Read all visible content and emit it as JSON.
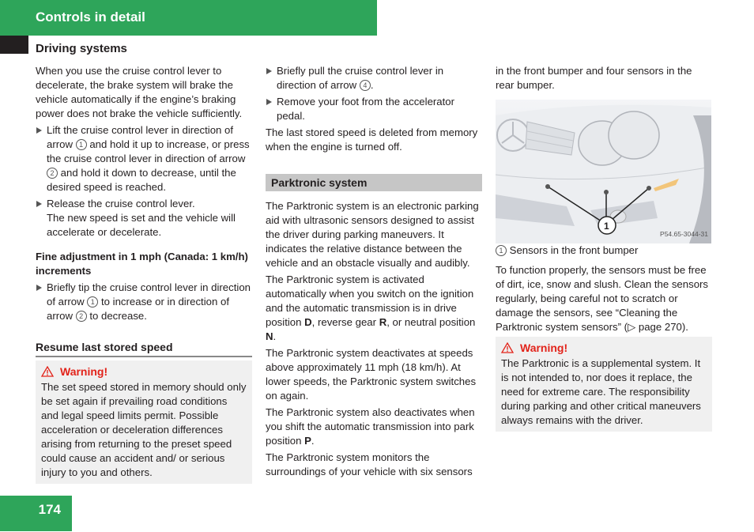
{
  "header": {
    "title": "Controls in detail"
  },
  "section_title": "Driving systems",
  "page_number": "174",
  "colors": {
    "accent_green": "#2ea55a",
    "warning_red": "#e2231a",
    "box_gray": "#f0f0f0",
    "heading_gray": "#c6c6c6"
  },
  "col1": {
    "intro": "When you use the cruise control lever to decelerate, the brake system will brake the vehicle automatically if the engine’s braking power does not brake the vehicle sufficiently.",
    "step1": {
      "a": "Lift the cruise control lever in direction of arrow",
      "n1": "1",
      "b": "and hold it up to increase, or press the cruise control lever in direction of arrow",
      "n2": "2",
      "c": "and hold it down to decrease, until the desired speed is reached."
    },
    "step2": {
      "a": "Release the cruise control lever.",
      "b": "The new speed is set and the vehicle will accelerate or decelerate."
    },
    "fine_heading": "Fine adjustment in 1 mph (Canada: 1 km/h) increments",
    "fine_step": {
      "a": "Briefly tip the cruise control lever in direction of arrow",
      "n1": "1",
      "b": "to increase or in direction of arrow",
      "n2": "2",
      "c": "to decrease."
    },
    "resume_heading": "Resume last stored speed",
    "warning": {
      "label": "Warning!",
      "text": "The set speed stored in memory should only be set again if prevailing road conditions and legal speed limits permit. Possible acceleration or deceleration differences arising from returning to the preset speed could cause an accident and/ or serious injury to you and others."
    }
  },
  "col2": {
    "step1": {
      "a": "Briefly pull the cruise control lever in direction of arrow",
      "n": "4",
      "b": "."
    },
    "step2": "Remove your foot from the accelerator pedal.",
    "note": "The last stored speed is deleted from memory when the engine is turned off.",
    "parktronic_heading": "Parktronic system",
    "p1": "The Parktronic system is an electronic parking aid with ultrasonic sensors designed to assist the driver during parking maneuvers. It indicates the relative distance between the vehicle and an obstacle visually and audibly.",
    "p2": {
      "a": "The Parktronic system is activated automatically when you switch on the ignition and the automatic transmission is in drive position ",
      "d": "D",
      "b": ", reverse gear ",
      "r": "R",
      "c": ", or neutral position ",
      "n": "N",
      "e": "."
    },
    "p3": "The Parktronic system deactivates at speeds above approximately 11 mph (18 km/h). At lower speeds, the Parktronic system switches on again.",
    "p4": {
      "a": "The Parktronic system also deactivates when you shift the automatic transmission into park position ",
      "p": "P",
      "b": "."
    },
    "p5": "The Parktronic system monitors the surroundings of your vehicle with six sensors"
  },
  "col3": {
    "cont": "in the front bumper and four sensors in the rear bumper.",
    "image": {
      "callout": "1",
      "code": "P54.65-3044-31",
      "alt": "car-front-bumper-sensors"
    },
    "caption": {
      "n": "1",
      "text": "Sensors in the front bumper"
    },
    "p1": "To function properly, the sensors must be free of dirt, ice, snow and slush. Clean the sensors regularly, being careful not to scratch or damage the sensors, see “Cleaning the Parktronic system sensors” (▷ page 270).",
    "warning": {
      "label": "Warning!",
      "text": "The Parktronic is a supplemental system. It is not intended to, nor does it replace, the need for extreme care. The responsibility during parking and other critical maneuvers always remains with the driver."
    }
  }
}
